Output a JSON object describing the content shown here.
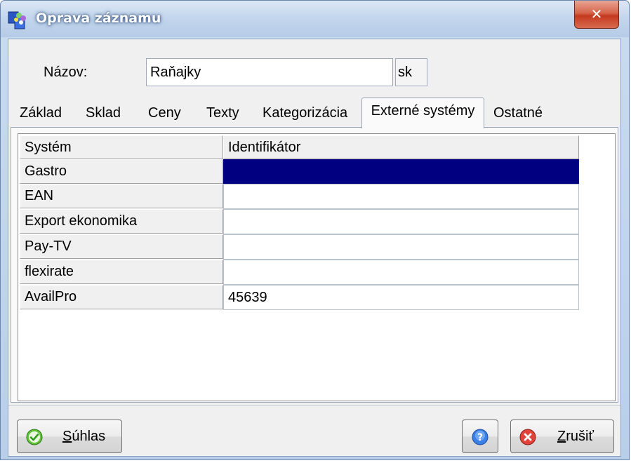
{
  "window": {
    "title": "Oprava záznamu",
    "close_glyph": "✕"
  },
  "form": {
    "name_label": "Názov:",
    "name_value": "Raňajky",
    "lang_button": "sk"
  },
  "tabs": [
    {
      "label": "Základ",
      "active": false
    },
    {
      "label": "Sklad",
      "active": false
    },
    {
      "label": "Ceny",
      "active": false
    },
    {
      "label": "Texty",
      "active": false
    },
    {
      "label": "Kategorizácia",
      "active": false
    },
    {
      "label": "Externé systémy",
      "active": true
    },
    {
      "label": "Ostatné",
      "active": false
    }
  ],
  "grid": {
    "columns": [
      "Systém",
      "Identifikátor"
    ],
    "rows": [
      {
        "system": "Gastro",
        "identifier": "",
        "selected": true
      },
      {
        "system": "EAN",
        "identifier": "",
        "selected": false
      },
      {
        "system": "Export ekonomika",
        "identifier": "",
        "selected": false
      },
      {
        "system": "Pay-TV",
        "identifier": "",
        "selected": false
      },
      {
        "system": "flexirate",
        "identifier": "",
        "selected": false
      },
      {
        "system": "AvailPro",
        "identifier": "45639",
        "selected": false
      }
    ]
  },
  "buttons": {
    "ok_label": "Súhlas",
    "help_icon": "help-icon",
    "cancel_label": "Zrušiť"
  },
  "colors": {
    "selection": "#000080",
    "close_button": "#c4391f",
    "ok_icon": "#4caf2a",
    "cancel_icon": "#d32f2f",
    "help_icon": "#2b6fd6"
  }
}
